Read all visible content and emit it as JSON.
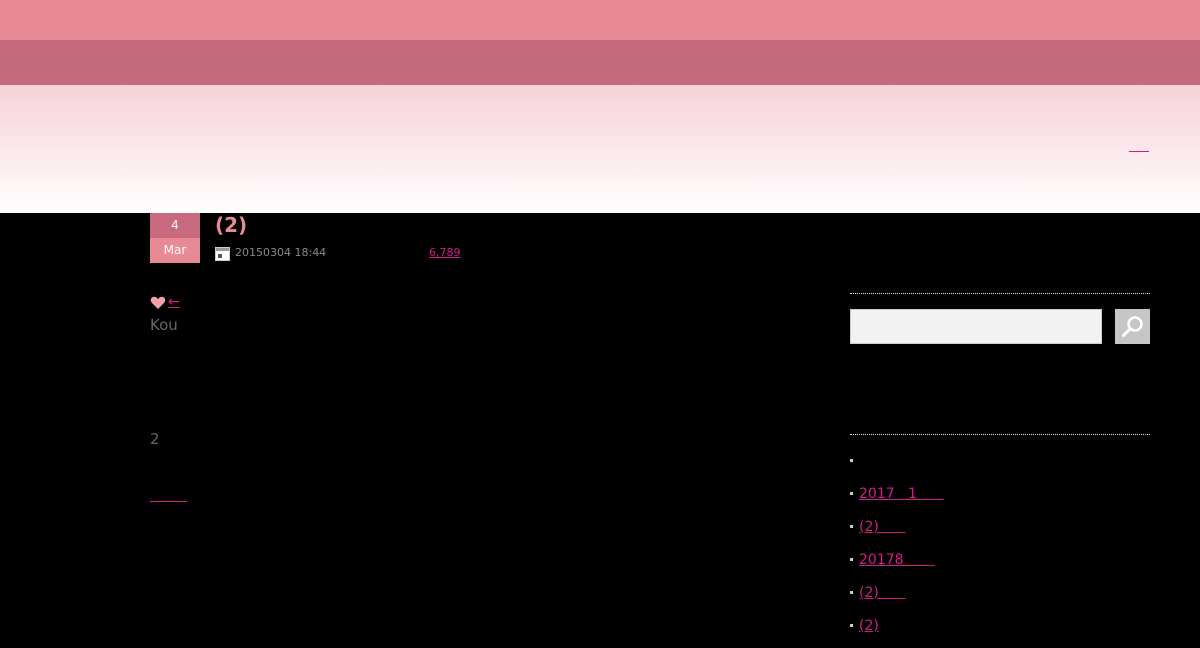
{
  "colors": {
    "top_bar": "#e88a94",
    "nav_bar": "#c5697f",
    "accent_link": "#d21e8c",
    "title": "#e88a94"
  },
  "post": {
    "date_day": "4",
    "date_month": "Mar",
    "title": "(2)",
    "posted": "20150304 18:44",
    "views": "6,789",
    "back_arrow": "←",
    "author": "Kou",
    "count": "2"
  },
  "sidebar": {
    "search_placeholder": "",
    "archive_items": [
      {
        "label": ""
      },
      {
        "label": "2017   1      "
      },
      {
        "label": "(2)      "
      },
      {
        "label": "20178       "
      },
      {
        "label": "(2)      "
      },
      {
        "label": "(2)"
      }
    ]
  }
}
